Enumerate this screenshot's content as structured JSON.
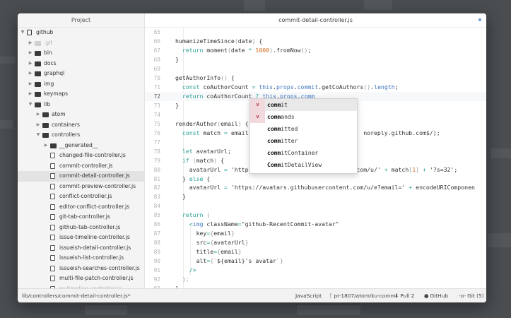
{
  "sidebar": {
    "title": "Project",
    "tree": [
      {
        "label": "github",
        "kind": "repo",
        "depth": 0,
        "expanded": true
      },
      {
        "label": ".git",
        "kind": "folder",
        "depth": 1,
        "expanded": false,
        "faded": true
      },
      {
        "label": "bin",
        "kind": "folder",
        "depth": 1,
        "expanded": false
      },
      {
        "label": "docs",
        "kind": "folder",
        "depth": 1,
        "expanded": false
      },
      {
        "label": "graphql",
        "kind": "folder",
        "depth": 1,
        "expanded": false
      },
      {
        "label": "img",
        "kind": "folder",
        "depth": 1,
        "expanded": false
      },
      {
        "label": "keymaps",
        "kind": "folder",
        "depth": 1,
        "expanded": false
      },
      {
        "label": "lib",
        "kind": "folder",
        "depth": 1,
        "expanded": true
      },
      {
        "label": "atom",
        "kind": "folder",
        "depth": 2,
        "expanded": false
      },
      {
        "label": "containers",
        "kind": "folder",
        "depth": 2,
        "expanded": false
      },
      {
        "label": "controllers",
        "kind": "folder",
        "depth": 2,
        "expanded": true
      },
      {
        "label": "__generated__",
        "kind": "folder",
        "depth": 3,
        "expanded": false
      },
      {
        "label": "changed-file-controller.js",
        "kind": "file",
        "depth": 3
      },
      {
        "label": "commit-controller.js",
        "kind": "file",
        "depth": 3
      },
      {
        "label": "commit-detail-controller.js",
        "kind": "file",
        "depth": 3,
        "selected": true
      },
      {
        "label": "commit-preview-controller.js",
        "kind": "file",
        "depth": 3
      },
      {
        "label": "conflict-controller.js",
        "kind": "file",
        "depth": 3
      },
      {
        "label": "editor-conflict-controller.js",
        "kind": "file",
        "depth": 3
      },
      {
        "label": "git-tab-controller.js",
        "kind": "file",
        "depth": 3
      },
      {
        "label": "github-tab-controller.js",
        "kind": "file",
        "depth": 3
      },
      {
        "label": "issue-timeline-controller.js",
        "kind": "file",
        "depth": 3
      },
      {
        "label": "issueish-detail-controller.js",
        "kind": "file",
        "depth": 3
      },
      {
        "label": "issueish-list-controller.js",
        "kind": "file",
        "depth": 3
      },
      {
        "label": "issueish-searches-controller.js",
        "kind": "file",
        "depth": 3
      },
      {
        "label": "multi-file-patch-controller.js",
        "kind": "file",
        "depth": 3
      },
      {
        "label": "pr-timeline-controller.js",
        "kind": "file",
        "depth": 3,
        "faded": true
      }
    ]
  },
  "editor": {
    "tab_title": "commit-detail-controller.js",
    "lines": [
      {
        "n": "65",
        "tokens": []
      },
      {
        "n": "66",
        "tokens": [
          [
            "tk-fn",
            "humanizeTimeSince"
          ],
          [
            "tk-punc",
            "("
          ],
          [
            "tk-plain",
            "date"
          ],
          [
            "tk-punc",
            ")"
          ],
          [
            "tk-plain",
            " {"
          ]
        ]
      },
      {
        "n": "67",
        "tokens": [
          [
            "tk-plain",
            "  "
          ],
          [
            "tk-kw",
            "return"
          ],
          [
            "tk-plain",
            " moment"
          ],
          [
            "tk-punc",
            "("
          ],
          [
            "tk-plain",
            "date "
          ],
          [
            "tk-op",
            "*"
          ],
          [
            "tk-plain",
            " "
          ],
          [
            "tk-num",
            "1000"
          ],
          [
            "tk-punc",
            ")"
          ],
          [
            "tk-plain",
            "."
          ],
          [
            "tk-fn",
            "fromNow"
          ],
          [
            "tk-punc",
            "()"
          ],
          [
            "tk-plain",
            ";"
          ]
        ]
      },
      {
        "n": "68",
        "tokens": [
          [
            "tk-plain",
            "}"
          ]
        ]
      },
      {
        "n": "69",
        "tokens": []
      },
      {
        "n": "70",
        "tokens": [
          [
            "tk-fn",
            "getAuthorInfo"
          ],
          [
            "tk-punc",
            "()"
          ],
          [
            "tk-plain",
            " {"
          ]
        ]
      },
      {
        "n": "71",
        "tokens": [
          [
            "tk-plain",
            "  "
          ],
          [
            "tk-kw",
            "const"
          ],
          [
            "tk-plain",
            " coAuthorCount "
          ],
          [
            "tk-op",
            "="
          ],
          [
            "tk-plain",
            " "
          ],
          [
            "tk-prop",
            "this"
          ],
          [
            "tk-plain",
            "."
          ],
          [
            "tk-prop",
            "props"
          ],
          [
            "tk-plain",
            "."
          ],
          [
            "tk-prop",
            "commit"
          ],
          [
            "tk-plain",
            "."
          ],
          [
            "tk-fn",
            "getCoAuthors"
          ],
          [
            "tk-punc",
            "()"
          ],
          [
            "tk-plain",
            "."
          ],
          [
            "tk-prop",
            "length"
          ],
          [
            "tk-plain",
            ";"
          ]
        ]
      },
      {
        "n": "72",
        "cursor": true,
        "tokens": [
          [
            "tk-plain",
            "  "
          ],
          [
            "tk-kw",
            "return"
          ],
          [
            "tk-plain",
            " coAuthorCount "
          ],
          [
            "tk-op",
            "?"
          ],
          [
            "tk-plain",
            " "
          ],
          [
            "tk-prop",
            "this"
          ],
          [
            "tk-plain",
            "."
          ],
          [
            "tk-prop",
            "props"
          ],
          [
            "tk-plain",
            "."
          ],
          [
            "tk-prop",
            "comm"
          ]
        ]
      },
      {
        "n": "73",
        "tokens": [
          [
            "tk-plain",
            "}"
          ]
        ]
      },
      {
        "n": "74",
        "tokens": []
      },
      {
        "n": "75",
        "tokens": [
          [
            "tk-fn",
            "renderAuthor"
          ],
          [
            "tk-punc",
            "("
          ],
          [
            "tk-plain",
            "email"
          ],
          [
            "tk-punc",
            ")"
          ],
          [
            "tk-plain",
            " {"
          ]
        ]
      },
      {
        "n": "76",
        "tokens": [
          [
            "tk-plain",
            "  "
          ],
          [
            "tk-kw",
            "const"
          ],
          [
            "tk-plain",
            " match "
          ],
          [
            "tk-op",
            "="
          ],
          [
            "tk-plain",
            " email                                 noreply.github.com$/);"
          ]
        ]
      },
      {
        "n": "77",
        "tokens": []
      },
      {
        "n": "78",
        "tokens": [
          [
            "tk-plain",
            "  "
          ],
          [
            "tk-kw",
            "let"
          ],
          [
            "tk-plain",
            " avatarUrl;"
          ]
        ]
      },
      {
        "n": "79",
        "tokens": [
          [
            "tk-plain",
            "  "
          ],
          [
            "tk-kw",
            "if"
          ],
          [
            "tk-plain",
            " "
          ],
          [
            "tk-punc",
            "("
          ],
          [
            "tk-plain",
            "match"
          ],
          [
            "tk-punc",
            ")"
          ],
          [
            "tk-plain",
            " {"
          ]
        ]
      },
      {
        "n": "80",
        "tokens": [
          [
            "tk-plain",
            "    avatarUrl "
          ],
          [
            "tk-op",
            "="
          ],
          [
            "tk-plain",
            " 'http                              .com/u/' "
          ],
          [
            "tk-op",
            "+"
          ],
          [
            "tk-plain",
            " match"
          ],
          [
            "tk-punc",
            "["
          ],
          [
            "tk-num",
            "1"
          ],
          [
            "tk-punc",
            "]"
          ],
          [
            "tk-plain",
            " "
          ],
          [
            "tk-op",
            "+"
          ],
          [
            "tk-plain",
            " '?s=32';"
          ]
        ]
      },
      {
        "n": "81",
        "tokens": [
          [
            "tk-plain",
            "  } "
          ],
          [
            "tk-kw",
            "else"
          ],
          [
            "tk-plain",
            " {"
          ]
        ]
      },
      {
        "n": "82",
        "tokens": [
          [
            "tk-plain",
            "    avatarUrl "
          ],
          [
            "tk-op",
            "="
          ],
          [
            "tk-plain",
            " 'https://avatars.githubusercontent.com/u/e?email=' "
          ],
          [
            "tk-op",
            "+"
          ],
          [
            "tk-plain",
            " encodeURIComponen"
          ]
        ]
      },
      {
        "n": "83",
        "tokens": [
          [
            "tk-plain",
            "  }"
          ]
        ]
      },
      {
        "n": "84",
        "tokens": []
      },
      {
        "n": "85",
        "tokens": [
          [
            "tk-plain",
            "  "
          ],
          [
            "tk-kw",
            "return"
          ],
          [
            "tk-plain",
            " "
          ],
          [
            "tk-punc",
            "("
          ]
        ]
      },
      {
        "n": "86",
        "tokens": [
          [
            "tk-plain",
            "    "
          ],
          [
            "tk-op",
            "<"
          ],
          [
            "tk-prop",
            "img"
          ],
          [
            "tk-plain",
            " className"
          ],
          [
            "tk-op",
            "="
          ],
          [
            "tk-plain",
            "\"github-RecentCommit-avatar\""
          ]
        ]
      },
      {
        "n": "87",
        "tokens": [
          [
            "tk-plain",
            "      key"
          ],
          [
            "tk-op",
            "="
          ],
          [
            "tk-punc",
            "{"
          ],
          [
            "tk-plain",
            "email"
          ],
          [
            "tk-punc",
            "}"
          ]
        ]
      },
      {
        "n": "88",
        "tokens": [
          [
            "tk-plain",
            "      src"
          ],
          [
            "tk-op",
            "="
          ],
          [
            "tk-punc",
            "{"
          ],
          [
            "tk-plain",
            "avatarUrl"
          ],
          [
            "tk-punc",
            "}"
          ]
        ]
      },
      {
        "n": "89",
        "tokens": [
          [
            "tk-plain",
            "      title"
          ],
          [
            "tk-op",
            "="
          ],
          [
            "tk-punc",
            "{"
          ],
          [
            "tk-plain",
            "email"
          ],
          [
            "tk-punc",
            "}"
          ]
        ]
      },
      {
        "n": "90",
        "tokens": [
          [
            "tk-plain",
            "      alt"
          ],
          [
            "tk-op",
            "="
          ],
          [
            "tk-punc",
            "{`"
          ],
          [
            "tk-plain",
            "${email}'s avatar"
          ],
          [
            "tk-punc",
            "`}"
          ]
        ]
      },
      {
        "n": "91",
        "tokens": [
          [
            "tk-plain",
            "    "
          ],
          [
            "tk-op",
            "/>"
          ]
        ]
      },
      {
        "n": "92",
        "tokens": [
          [
            "tk-plain",
            "  "
          ],
          [
            "tk-punc",
            ");"
          ]
        ]
      },
      {
        "n": "93",
        "tokens": [
          [
            "tk-plain",
            "}"
          ]
        ]
      }
    ]
  },
  "autocomplete": {
    "items": [
      {
        "match": "comm",
        "rest": "it",
        "badge": "v",
        "selected": true
      },
      {
        "match": "comm",
        "rest": "ands",
        "badge": "v"
      },
      {
        "match": "comm",
        "rest": "itted",
        "badge": ""
      },
      {
        "match": "comm",
        "rest": "itter",
        "badge": ""
      },
      {
        "match": "comm",
        "rest": "itContainer",
        "badge": ""
      },
      {
        "match": "Comm",
        "rest": "itDetailView",
        "badge": ""
      }
    ]
  },
  "statusbar": {
    "file_path": "lib/controllers/commit-detail-controller.js*",
    "language": "JavaScript",
    "branch": "pr-1807/atom/ku-comm",
    "pull": "Pull 2",
    "github": "GitHub",
    "git": "Git (5)"
  }
}
